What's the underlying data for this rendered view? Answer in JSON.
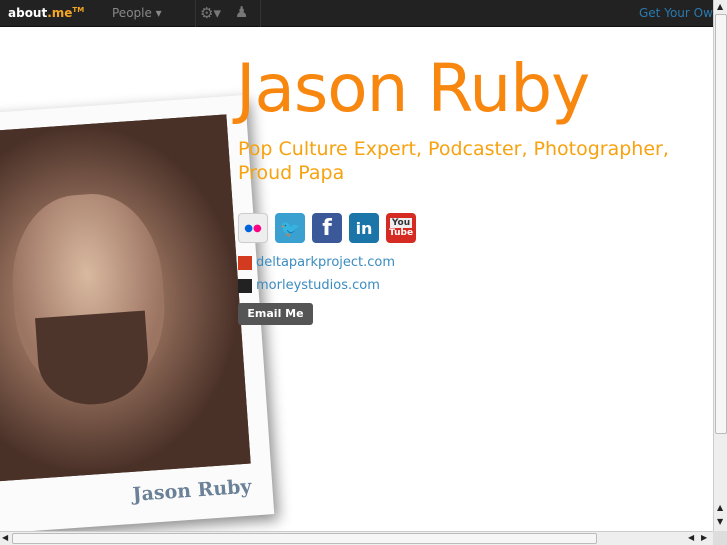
{
  "topbar": {
    "logo_main": "about",
    "logo_accent": ".me",
    "logo_tm": "TM",
    "people": "People ▾",
    "gear": "⚙▾",
    "add_person": "👤",
    "get_own": "Get Your Own"
  },
  "profile": {
    "name": "Jason Ruby",
    "headline": "Pop Culture Expert, Podcaster, Photographer, Proud Papa",
    "photo_caption": "Jason Ruby"
  },
  "social": [
    {
      "name": "flickr",
      "label": "●●",
      "color": "#eeeeee"
    },
    {
      "name": "twitter",
      "label": "🐦",
      "color": "#3aa0d0"
    },
    {
      "name": "facebook",
      "label": "f",
      "color": "#3b5998"
    },
    {
      "name": "linkedin",
      "label": "in",
      "color": "#1b75a8"
    },
    {
      "name": "youtube",
      "label": "You Tube",
      "color": "#d62b22"
    }
  ],
  "links": [
    "deltaparkproject.com",
    "morleystudios.com"
  ],
  "email_label": "Email Me"
}
